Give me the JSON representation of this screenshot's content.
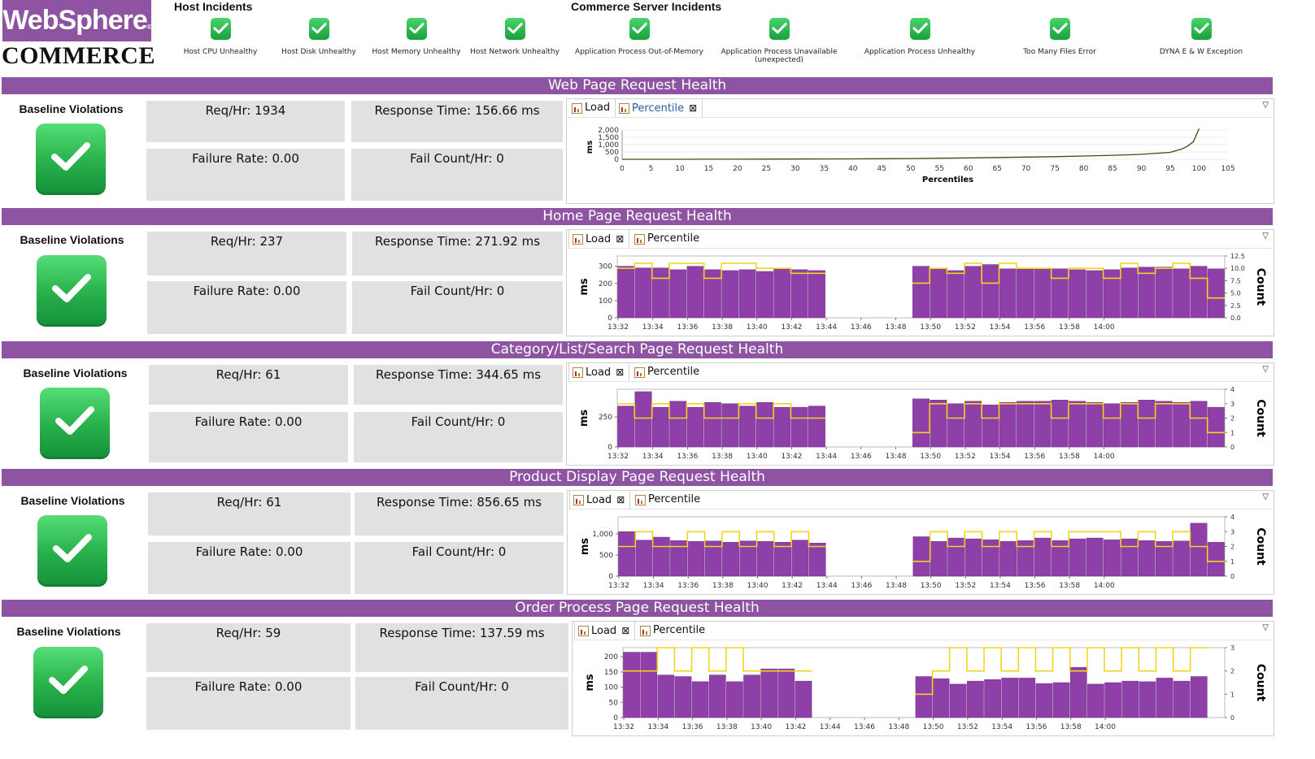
{
  "brand": {
    "top": "WebSphere",
    "reg": "®",
    "bottom": "COMMERCE"
  },
  "host_incidents": {
    "title": "Host Incidents",
    "items": [
      "Host CPU Unhealthy",
      "Host Disk Unhealthy",
      "Host Memory Unhealthy",
      "Host Network Unhealthy"
    ]
  },
  "commerce_incidents": {
    "title": "Commerce Server Incidents",
    "items": [
      "Application Process Out-of-Memory",
      "Application Process Unavailable (unexpected)",
      "Application Process Unhealthy",
      "Too Many Files Error",
      "DYNA E & W Exception"
    ]
  },
  "colors": {
    "accent": "#8e54a1",
    "ok": "#27b04a",
    "bar": "#8e3fa8",
    "line": "#f2d51a",
    "curve": "#3e4a12",
    "panel": "#e1e1e1"
  },
  "sections": [
    {
      "title": "Web Page Request Health",
      "baseline_label": "Baseline Violations",
      "req": "Req/Hr: 1934",
      "resp": "Response Time: 156.66 ms",
      "failure": "Failure Rate: 0.00",
      "failcount": "Fail Count/Hr: 0",
      "tabs": [
        "Load",
        "Percentile"
      ],
      "active_tab": "Percentile",
      "chart": {
        "type": "line",
        "ylabel": "ms",
        "xlabel": "Percentiles",
        "yticks": [
          "2,000",
          "1,500",
          "1,000",
          "500",
          "0"
        ],
        "xticks": [
          "0",
          "5",
          "10",
          "15",
          "20",
          "25",
          "30",
          "35",
          "40",
          "45",
          "50",
          "55",
          "60",
          "65",
          "70",
          "75",
          "80",
          "85",
          "90",
          "95",
          "100",
          "105"
        ],
        "points": [
          [
            0,
            0
          ],
          [
            5,
            0
          ],
          [
            10,
            2
          ],
          [
            15,
            5
          ],
          [
            20,
            8
          ],
          [
            25,
            12
          ],
          [
            30,
            18
          ],
          [
            35,
            24
          ],
          [
            40,
            30
          ],
          [
            45,
            40
          ],
          [
            50,
            52
          ],
          [
            55,
            70
          ],
          [
            60,
            95
          ],
          [
            65,
            120
          ],
          [
            70,
            150
          ],
          [
            75,
            180
          ],
          [
            80,
            220
          ],
          [
            85,
            270
          ],
          [
            90,
            340
          ],
          [
            95,
            470
          ],
          [
            97,
            700
          ],
          [
            98,
            900
          ],
          [
            99,
            1200
          ],
          [
            100,
            2100
          ]
        ],
        "xlim": [
          0,
          105
        ],
        "ylim": [
          0,
          2000
        ]
      }
    },
    {
      "title": "Home Page Request Health",
      "baseline_label": "Baseline Violations",
      "req": "Req/Hr: 237",
      "resp": "Response Time: 271.92 ms",
      "failure": "Failure Rate: 0.00",
      "failcount": "Fail Count/Hr: 0",
      "tabs": [
        "Load",
        "Percentile"
      ],
      "active_tab": "Load",
      "chart": {
        "type": "bar_count",
        "ylabel": "ms",
        "y2label": "Count",
        "yticks": [
          "300",
          "200",
          "100",
          "0"
        ],
        "ylim": [
          0,
          360
        ],
        "y2ticks": [
          "12.5",
          "10.0",
          "7.5",
          "5.0",
          "2.5",
          "0.0"
        ],
        "y2lim": [
          0,
          12.5
        ],
        "xticks": [
          "13:32",
          "13:34",
          "13:36",
          "13:38",
          "13:40",
          "13:42",
          "13:44",
          "13:46",
          "13:48",
          "13:50",
          "13:52",
          "13:54",
          "13:56",
          "13:58",
          "14:00"
        ],
        "bars": [
          300,
          290,
          290,
          280,
          300,
          280,
          275,
          280,
          270,
          285,
          280,
          275,
          0,
          0,
          0,
          0,
          0,
          300,
          290,
          275,
          300,
          310,
          285,
          285,
          290,
          285,
          280,
          275,
          280,
          290,
          295,
          295,
          285,
          300,
          285
        ],
        "counts": [
          10,
          11,
          8,
          11,
          11,
          8,
          11,
          11,
          10,
          10,
          9,
          9,
          0,
          0,
          0,
          0,
          0,
          7,
          10,
          9,
          11,
          7,
          11,
          10,
          10,
          8,
          10,
          10,
          8,
          11,
          9,
          10,
          11,
          8,
          4
        ]
      }
    },
    {
      "title": "Category/List/Search Page Request Health",
      "baseline_label": "Baseline Violations",
      "req": "Req/Hr: 61",
      "resp": "Response Time: 344.65 ms",
      "failure": "Failure Rate: 0.00",
      "failcount": "Fail Count/Hr: 0",
      "tabs": [
        "Load",
        "Percentile"
      ],
      "active_tab": "Load",
      "chart": {
        "type": "bar_count",
        "ylabel": "ms",
        "y2label": "Count",
        "yticks": [
          "250",
          "0"
        ],
        "ylim": [
          0,
          480
        ],
        "y2ticks": [
          "4",
          "3",
          "2",
          "1",
          "0"
        ],
        "y2lim": [
          0,
          4
        ],
        "xticks": [
          "13:32",
          "13:34",
          "13:36",
          "13:38",
          "13:40",
          "13:42",
          "13:44",
          "13:46",
          "13:48",
          "13:50",
          "13:52",
          "13:54",
          "13:56",
          "13:58",
          "14:00"
        ],
        "bars": [
          340,
          460,
          330,
          380,
          330,
          370,
          360,
          340,
          370,
          330,
          330,
          340,
          0,
          0,
          0,
          0,
          0,
          400,
          390,
          360,
          380,
          350,
          370,
          380,
          380,
          390,
          380,
          370,
          360,
          370,
          390,
          380,
          370,
          380,
          330
        ],
        "counts": [
          3,
          2,
          3,
          2,
          3,
          2,
          2,
          3,
          2,
          3,
          2,
          2,
          0,
          0,
          0,
          0,
          0,
          1,
          3,
          2,
          3,
          2,
          3,
          3,
          3,
          2,
          3,
          3,
          2,
          3,
          2,
          3,
          3,
          2,
          1
        ]
      }
    },
    {
      "title": "Product Display Page Request Health",
      "baseline_label": "Baseline Violations",
      "req": "Req/Hr: 61",
      "resp": "Response Time: 856.65 ms",
      "failure": "Failure Rate: 0.00",
      "failcount": "Fail Count/Hr: 0",
      "tabs": [
        "Load",
        "Percentile"
      ],
      "active_tab": "Load",
      "chart": {
        "type": "bar_count",
        "ylabel": "ms",
        "y2label": "Count",
        "yticks": [
          "1,000",
          "500",
          "0"
        ],
        "ylim": [
          0,
          1400
        ],
        "y2ticks": [
          "4",
          "3",
          "2",
          "1",
          "0"
        ],
        "y2lim": [
          0,
          4
        ],
        "xticks": [
          "13:32",
          "13:34",
          "13:36",
          "13:38",
          "13:40",
          "13:42",
          "13:44",
          "13:46",
          "13:48",
          "13:50",
          "13:52",
          "13:54",
          "13:56",
          "13:58",
          "14:00"
        ],
        "bars": [
          1050,
          850,
          920,
          840,
          820,
          830,
          800,
          830,
          820,
          800,
          850,
          780,
          0,
          0,
          0,
          0,
          0,
          930,
          820,
          900,
          880,
          860,
          820,
          840,
          900,
          840,
          880,
          900,
          860,
          880,
          840,
          820,
          830,
          1250,
          800
        ],
        "counts": [
          2,
          3,
          2,
          2,
          3,
          2,
          3,
          2,
          3,
          2,
          3,
          2,
          0,
          0,
          0,
          0,
          0,
          1,
          3,
          2,
          3,
          2,
          3,
          2,
          3,
          2,
          3,
          3,
          3,
          2,
          3,
          2,
          3,
          2,
          1
        ]
      }
    },
    {
      "title": "Order Process Page Request Health",
      "baseline_label": "Baseline Violations",
      "req": "Req/Hr: 59",
      "resp": "Response Time: 137.59 ms",
      "failure": "Failure Rate: 0.00",
      "failcount": "Fail Count/Hr: 0",
      "tabs": [
        "Load",
        "Percentile"
      ],
      "active_tab": "Load",
      "chart": {
        "type": "bar_count",
        "ylabel": "ms",
        "y2label": "Count",
        "yticks": [
          "200",
          "150",
          "100",
          "50",
          "0"
        ],
        "ylim": [
          0,
          230
        ],
        "y2ticks": [
          "3",
          "2",
          "1",
          "0"
        ],
        "y2lim": [
          0,
          3
        ],
        "xticks": [
          "13:32",
          "13:34",
          "13:36",
          "13:38",
          "13:40",
          "13:42",
          "13:44",
          "13:46",
          "13:48",
          "13:50",
          "13:52",
          "13:54",
          "13:56",
          "13:58",
          "14:00"
        ],
        "bars": [
          215,
          215,
          140,
          135,
          118,
          140,
          118,
          140,
          160,
          160,
          120,
          0,
          0,
          0,
          0,
          0,
          0,
          135,
          128,
          110,
          120,
          125,
          130,
          130,
          112,
          115,
          165,
          110,
          115,
          120,
          118,
          130,
          120,
          135,
          0
        ],
        "counts": [
          2,
          2,
          3,
          2,
          3,
          2,
          3,
          2,
          2,
          2,
          2,
          0,
          0,
          0,
          0,
          0,
          0,
          1,
          2,
          3,
          2,
          3,
          2,
          3,
          2,
          3,
          2,
          3,
          2,
          3,
          2,
          3,
          2,
          3,
          0
        ]
      }
    }
  ]
}
